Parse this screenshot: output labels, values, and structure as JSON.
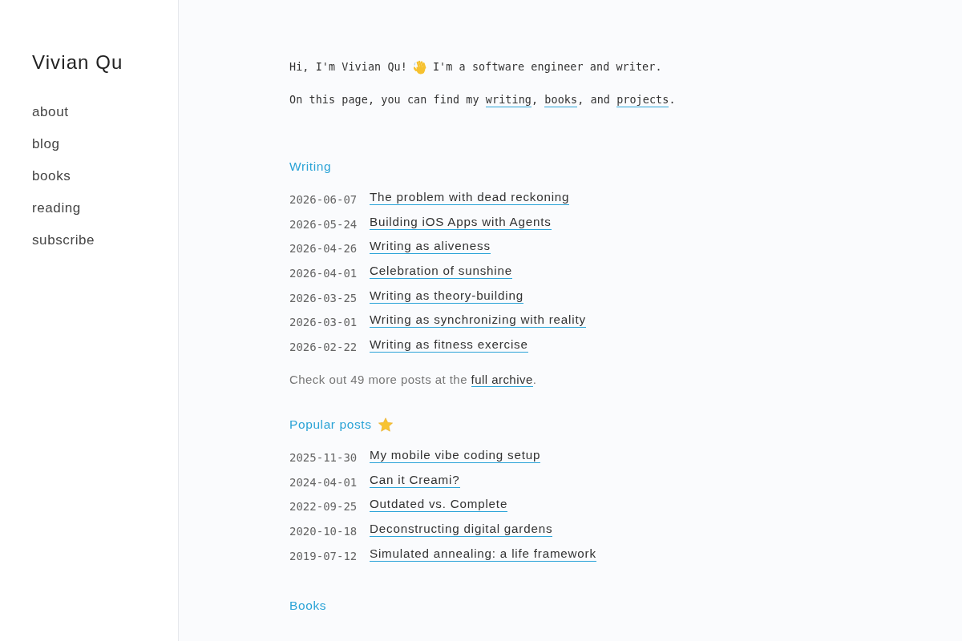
{
  "sidebar": {
    "title": "Vivian Qu",
    "nav": [
      "about",
      "blog",
      "books",
      "reading",
      "subscribe"
    ]
  },
  "intro": {
    "greeting": "Hi, I'm Vivian Qu!",
    "tagline": "I'm a software engineer and writer.",
    "sentence": [
      {
        "kind": "text",
        "text": "On this page, you can find my "
      },
      {
        "kind": "link",
        "text": "writing"
      },
      {
        "kind": "text",
        "text": ", "
      },
      {
        "kind": "link",
        "text": "books"
      },
      {
        "kind": "text",
        "text": ", and "
      },
      {
        "kind": "link",
        "text": "projects"
      },
      {
        "kind": "text",
        "text": "."
      }
    ]
  },
  "sections": [
    {
      "kind": "plain",
      "title": "Writing",
      "posts": [
        {
          "date": "2026-06-07",
          "title": "The problem with dead reckoning"
        },
        {
          "date": "2026-05-24",
          "title": "Building iOS Apps with Agents"
        },
        {
          "date": "2026-04-26",
          "title": "Writing as aliveness"
        },
        {
          "date": "2026-04-01",
          "title": "Celebration of sunshine"
        },
        {
          "date": "2026-03-25",
          "title": "Writing as theory-building"
        },
        {
          "date": "2026-03-01",
          "title": "Writing as synchronizing with reality"
        },
        {
          "date": "2026-02-22",
          "title": "Writing as fitness exercise"
        }
      ],
      "footer": [
        {
          "kind": "text",
          "text": "Check out 49 more posts at the "
        },
        {
          "kind": "link",
          "text": "full archive"
        },
        {
          "kind": "text",
          "text": "."
        }
      ]
    },
    {
      "kind": "featured",
      "title": "Popular posts",
      "posts": [
        {
          "date": "2025-11-30",
          "title": "My mobile vibe coding setup"
        },
        {
          "date": "2024-04-01",
          "title": "Can it Creami?"
        },
        {
          "date": "2022-09-25",
          "title": "Outdated vs. Complete"
        },
        {
          "date": "2020-10-18",
          "title": "Deconstructing digital gardens"
        },
        {
          "date": "2019-07-12",
          "title": "Simulated annealing: a life framework"
        }
      ]
    },
    {
      "kind": "plain",
      "title": "Books"
    }
  ]
}
